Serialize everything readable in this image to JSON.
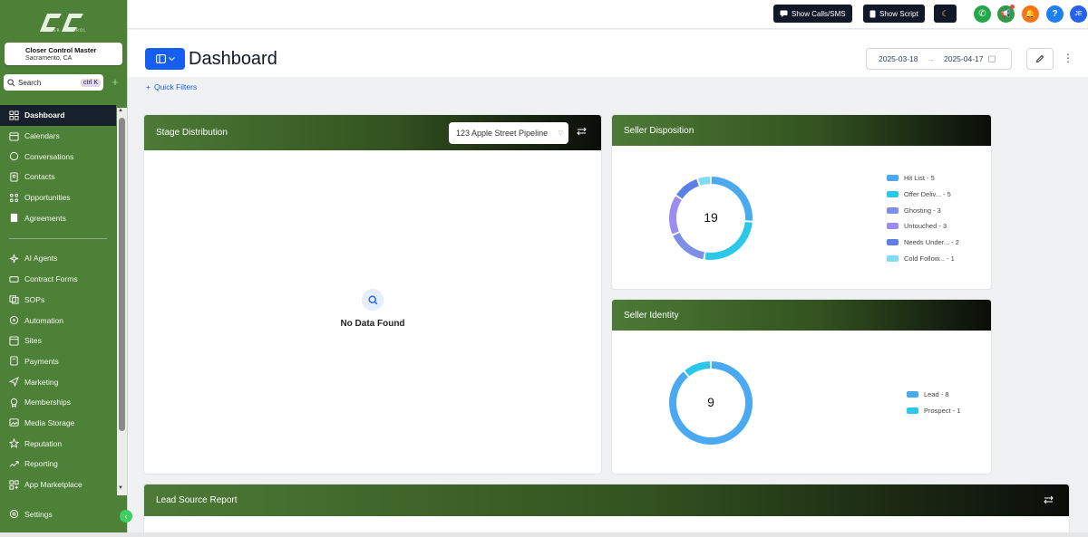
{
  "app": {
    "logo_text": "CLOSER CONTROL",
    "location_name": "Closer Control Master",
    "location_city": "Sacramento, CA"
  },
  "search": {
    "label": "Search",
    "shortcut": "ctrl K"
  },
  "nav": {
    "items": [
      {
        "label": "Dashboard",
        "icon": "grid-icon",
        "active": true
      },
      {
        "label": "Calendars",
        "icon": "calendar-icon"
      },
      {
        "label": "Conversations",
        "icon": "chat-icon"
      },
      {
        "label": "Contacts",
        "icon": "contacts-icon"
      },
      {
        "label": "Opportunities",
        "icon": "opportunities-icon"
      },
      {
        "label": "Agreements",
        "icon": "document-icon"
      }
    ],
    "items2": [
      {
        "label": "AI Agents",
        "icon": "sparkle-icon"
      },
      {
        "label": "Contract Forms",
        "icon": "forms-icon"
      },
      {
        "label": "SOPs",
        "icon": "sops-icon"
      },
      {
        "label": "Automation",
        "icon": "automation-icon"
      },
      {
        "label": "Sites",
        "icon": "sites-icon"
      },
      {
        "label": "Payments",
        "icon": "payments-icon"
      },
      {
        "label": "Marketing",
        "icon": "send-icon"
      },
      {
        "label": "Memberships",
        "icon": "membership-icon"
      },
      {
        "label": "Media Storage",
        "icon": "image-icon"
      },
      {
        "label": "Reputation",
        "icon": "star-icon"
      },
      {
        "label": "Reporting",
        "icon": "trend-icon"
      },
      {
        "label": "App Marketplace",
        "icon": "marketplace-icon"
      }
    ],
    "settings": "Settings"
  },
  "topbar": {
    "show_calls": "Show Calls/SMS",
    "show_script": "Show Script",
    "avatar": "JE",
    "help": "?"
  },
  "header": {
    "title": "Dashboard",
    "date_start": "2025-03-18",
    "date_end": "2025-04-17",
    "quick_filters": "Quick Filters"
  },
  "stage_distribution": {
    "title": "Stage Distribution",
    "pipeline": "123 Apple Street Pipeline",
    "empty": "No Data Found"
  },
  "seller_disposition": {
    "title": "Seller Disposition",
    "total": "19",
    "legend": [
      {
        "label": "Hit List - 5",
        "color": "#4aa9f0",
        "value": 5
      },
      {
        "label": "Offer Deliv... - 5",
        "color": "#2cc8ea",
        "value": 5
      },
      {
        "label": "Ghosting - 3",
        "color": "#7d8ee8",
        "value": 3
      },
      {
        "label": "Untouched - 3",
        "color": "#9b8cef",
        "value": 3
      },
      {
        "label": "Needs Under... - 2",
        "color": "#5b7fe6",
        "value": 2
      },
      {
        "label": "Cold Follow... - 1",
        "color": "#7edcf3",
        "value": 1
      }
    ]
  },
  "seller_identity": {
    "title": "Seller Identity",
    "total": "9",
    "legend": [
      {
        "label": "Lead - 8",
        "color": "#4aa9f0",
        "value": 8
      },
      {
        "label": "Prospect - 1",
        "color": "#2cc8ea",
        "value": 1
      }
    ]
  },
  "lead_source": {
    "title": "Lead Source Report"
  }
}
